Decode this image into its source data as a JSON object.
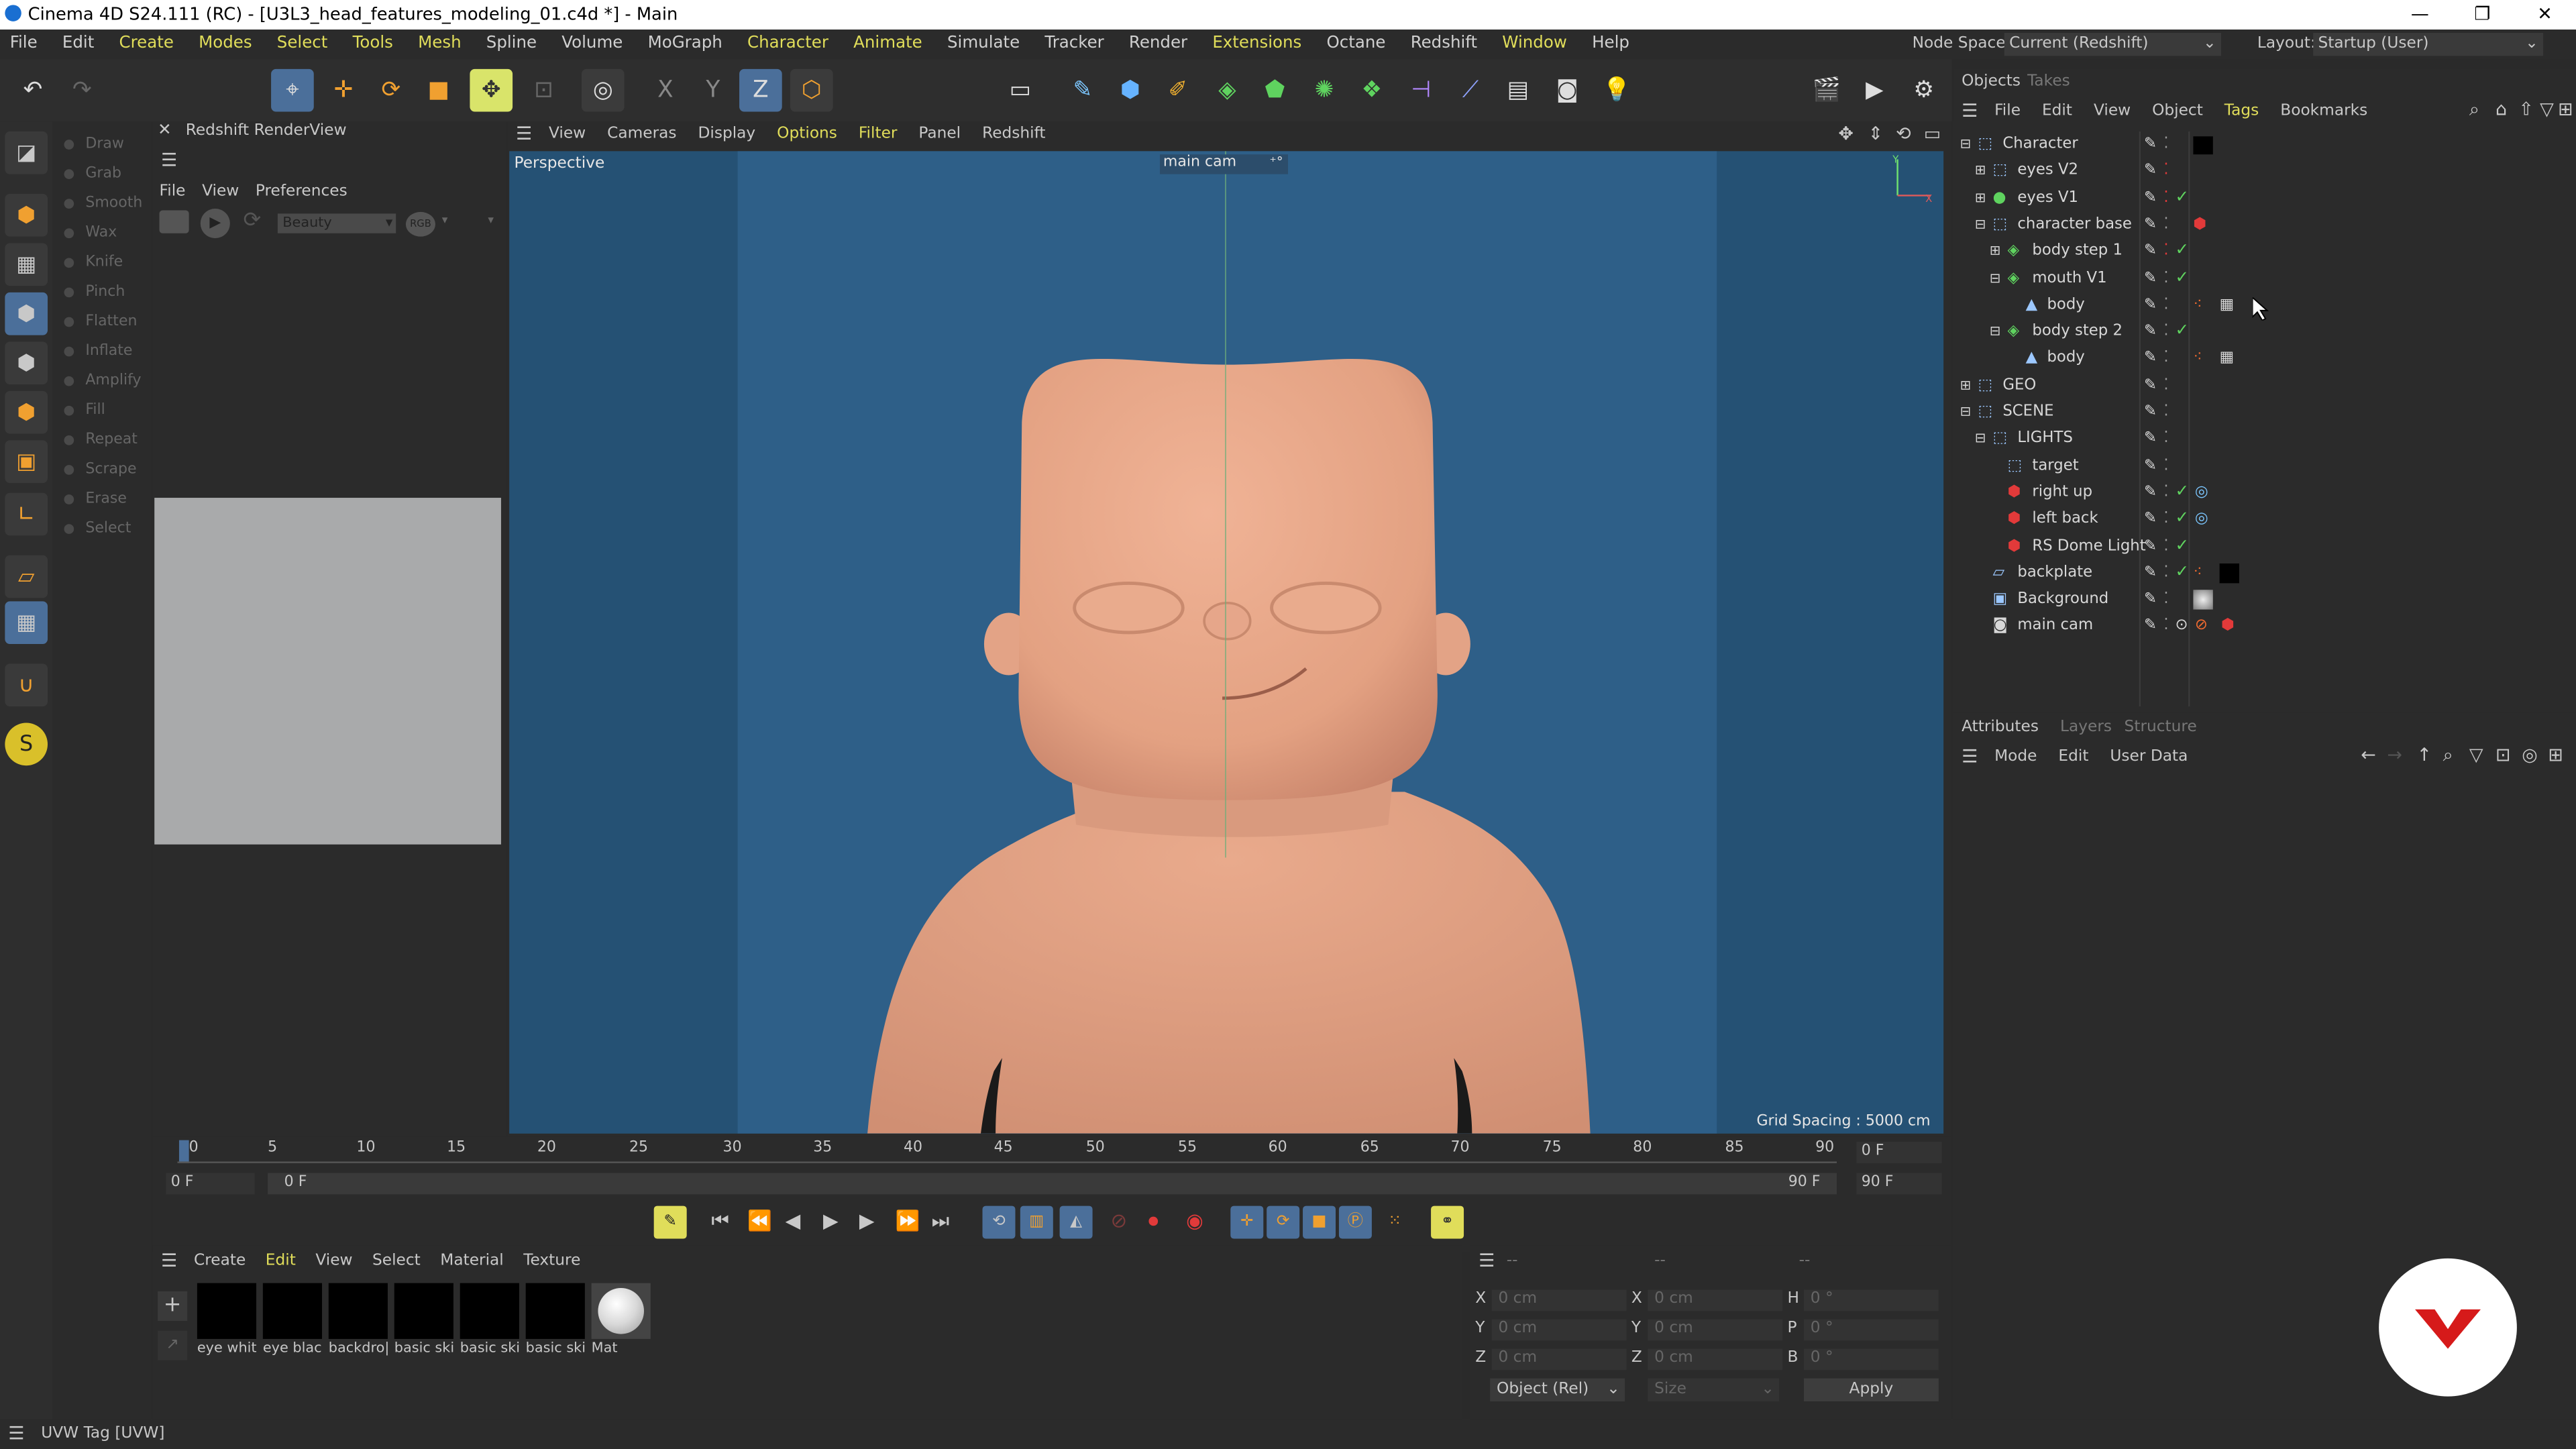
{
  "window": {
    "title": "Cinema 4D S24.111 (RC) - [U3L3_head_features_modeling_01.c4d *] - Main",
    "controls": [
      "—",
      "❐",
      "✕"
    ]
  },
  "menu": [
    "File",
    "Edit",
    "Create",
    "Modes",
    "Select",
    "Tools",
    "Mesh",
    "Spline",
    "Volume",
    "MoGraph",
    "Character",
    "Animate",
    "Simulate",
    "Tracker",
    "Render",
    "Extensions",
    "Octane",
    "Redshift",
    "Window",
    "Help"
  ],
  "node_space": {
    "label": "Node Space:",
    "value": "Current (Redshift)"
  },
  "layout": {
    "label": "Layout:",
    "value": "Startup (User)"
  },
  "sculpt_tools": [
    "Draw",
    "Grab",
    "Smooth",
    "Wax",
    "Knife",
    "Pinch",
    "Flatten",
    "Inflate",
    "Amplify",
    "Fill",
    "Repeat",
    "Scrape",
    "Erase",
    "Select"
  ],
  "renderview": {
    "title": "Redshift RenderView",
    "menu": [
      "File",
      "View",
      "Preferences"
    ],
    "aov": "Beauty",
    "rgb": "RGB"
  },
  "viewport": {
    "menu": [
      "View",
      "Cameras",
      "Display",
      "Options",
      "Filter",
      "Panel",
      "Redshift"
    ],
    "label": "Perspective",
    "camera": "main cam",
    "grid_spacing": "Grid Spacing : 5000 cm"
  },
  "timeline": {
    "ticks": [
      "0",
      "5",
      "10",
      "15",
      "20",
      "25",
      "30",
      "35",
      "40",
      "45",
      "50",
      "55",
      "60",
      "65",
      "70",
      "75",
      "80",
      "85",
      "90"
    ],
    "current": "0 F",
    "start": "0 F",
    "range_start": "0 F",
    "range_end": "90 F",
    "end": "90 F"
  },
  "objects_panel": {
    "tabs": [
      "Objects",
      "Takes"
    ],
    "menu": [
      "File",
      "Edit",
      "View",
      "Object",
      "Tags",
      "Bookmarks"
    ],
    "rows": [
      {
        "name": "Character",
        "indent": 0
      },
      {
        "name": "eyes V2",
        "indent": 1
      },
      {
        "name": "eyes V1",
        "indent": 1
      },
      {
        "name": "character base",
        "indent": 1
      },
      {
        "name": "body step 1",
        "indent": 2
      },
      {
        "name": "mouth V1",
        "indent": 2
      },
      {
        "name": "body",
        "indent": 3
      },
      {
        "name": "body step 2",
        "indent": 2
      },
      {
        "name": "body",
        "indent": 3
      },
      {
        "name": "GEO",
        "indent": 0
      },
      {
        "name": "SCENE",
        "indent": 0
      },
      {
        "name": "LIGHTS",
        "indent": 1
      },
      {
        "name": "target",
        "indent": 2
      },
      {
        "name": "right up",
        "indent": 2
      },
      {
        "name": "left back",
        "indent": 2
      },
      {
        "name": "RS Dome Light",
        "indent": 2
      },
      {
        "name": "backplate",
        "indent": 1
      },
      {
        "name": "Background",
        "indent": 1
      },
      {
        "name": "main cam",
        "indent": 1
      }
    ]
  },
  "attributes_panel": {
    "tabs": [
      "Attributes",
      "Layers",
      "Structure"
    ],
    "menu": [
      "Mode",
      "Edit",
      "User Data"
    ]
  },
  "material_panel": {
    "menu": [
      "Create",
      "Edit",
      "View",
      "Select",
      "Material",
      "Texture"
    ],
    "materials": [
      "eye whit",
      "eye blac",
      "backdro|",
      "basic ski",
      "basic ski",
      "basic ski",
      "Mat"
    ]
  },
  "coordinates": {
    "header": [
      "--",
      "--",
      "--"
    ],
    "rows": [
      {
        "a": "X",
        "av": "0 cm",
        "b": "X",
        "bv": "0 cm",
        "c": "H",
        "cv": "0 °"
      },
      {
        "a": "Y",
        "av": "0 cm",
        "b": "Y",
        "bv": "0 cm",
        "c": "P",
        "cv": "0 °"
      },
      {
        "a": "Z",
        "av": "0 cm",
        "b": "Z",
        "bv": "0 cm",
        "c": "B",
        "cv": "0 °"
      }
    ],
    "mode": "Object (Rel)",
    "size": "Size",
    "apply": "Apply"
  },
  "status": "UVW Tag [UVW]",
  "colors": {
    "viewport_bg": "#2e5f88",
    "viewport_side": "#255174",
    "skin": "#e8a586",
    "accent": "#e0dd5a",
    "logo": "#d61a1a"
  }
}
